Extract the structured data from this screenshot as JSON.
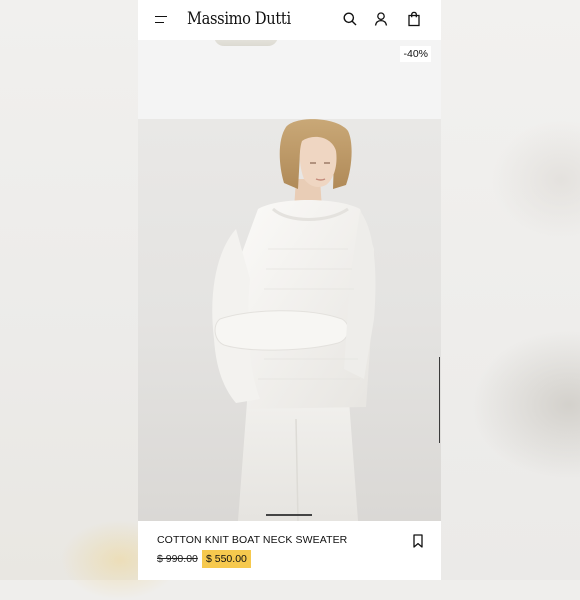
{
  "header": {
    "brand": "Massimo Dutti",
    "icons": [
      "menu-icon",
      "search-icon",
      "account-icon",
      "shopping-bag-icon"
    ]
  },
  "previous_product": {
    "discount_badge": "-40%"
  },
  "product": {
    "name": "COTTON KNIT BOAT NECK SWEATER",
    "original_price": "$ 990.00",
    "sale_price": "$ 550.00",
    "highlight_color": "#f6c94e"
  },
  "carousel": {
    "slide_count_hint": "carousel-indicator"
  }
}
